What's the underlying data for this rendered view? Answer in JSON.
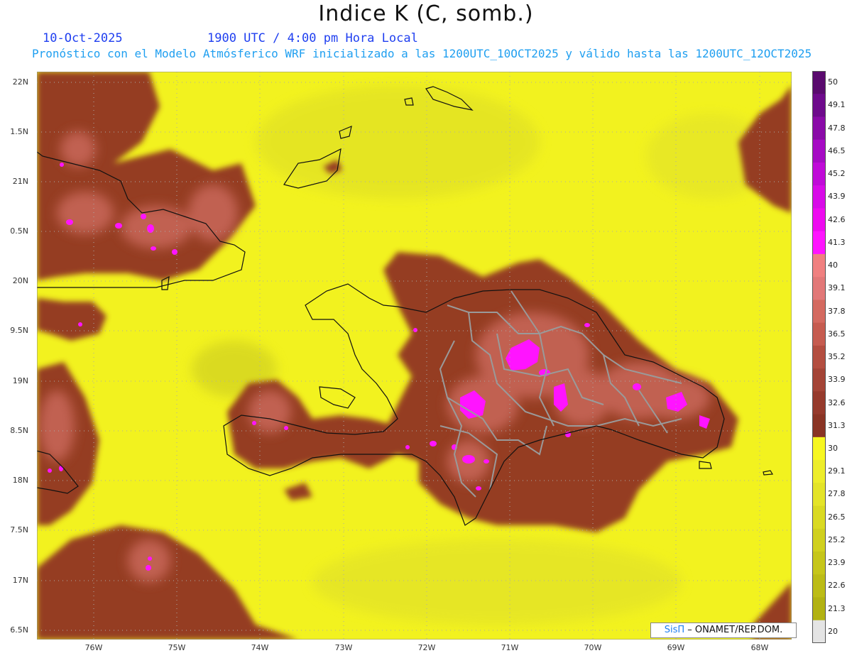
{
  "title": "Indice K (C, somb.)",
  "date": "10-Oct-2025",
  "time_label": "1900 UTC / 4:00 pm Hora Local",
  "forecast_text": "Pronóstico con el Modelo Atmósferico WRF inicializado a las 1200UTC_10OCT2025 y válido hasta las  1200UTC_12OCT2025",
  "lat_labels": [
    "22N",
    "1.5N",
    "21N",
    "0.5N",
    "20N",
    "9.5N",
    "19N",
    "8.5N",
    "18N",
    "7.5N",
    "17N",
    "6.5N"
  ],
  "lon_labels": [
    "76W",
    "75W",
    "74W",
    "73W",
    "72W",
    "71W",
    "70W",
    "69W",
    "68W"
  ],
  "colorbar": {
    "labels": [
      "50",
      "49.1",
      "47.8",
      "46.5",
      "45.2",
      "43.9",
      "42.6",
      "41.3",
      "40",
      "39.1",
      "37.8",
      "36.5",
      "35.2",
      "33.9",
      "32.6",
      "31.3",
      "30",
      "29.1",
      "27.8",
      "26.5",
      "25.2",
      "23.9",
      "22.6",
      "21.3",
      "20"
    ],
    "colors": [
      "#5a0a6e",
      "#6e0a8c",
      "#8a0aa8",
      "#a60ac4",
      "#c00ad8",
      "#d80ae8",
      "#ee0af0",
      "#ff14ff",
      "#f08080",
      "#e27878",
      "#d46a60",
      "#c65c50",
      "#b44e40",
      "#a44436",
      "#963a2c",
      "#8a3424",
      "#f7f720",
      "#eded2a",
      "#e4e428",
      "#dada22",
      "#d0d01e",
      "#c6c61a",
      "#bcbc16",
      "#b2b212",
      "#e4e4e4"
    ]
  },
  "credit": {
    "sis": "SisΠ",
    "rest": " – ONAMET/REP.DOM."
  },
  "colors": {
    "yellow": "#f2f21f",
    "brown": "#953c22",
    "salmon": "#c9685a",
    "magenta": "#ff14ff"
  }
}
